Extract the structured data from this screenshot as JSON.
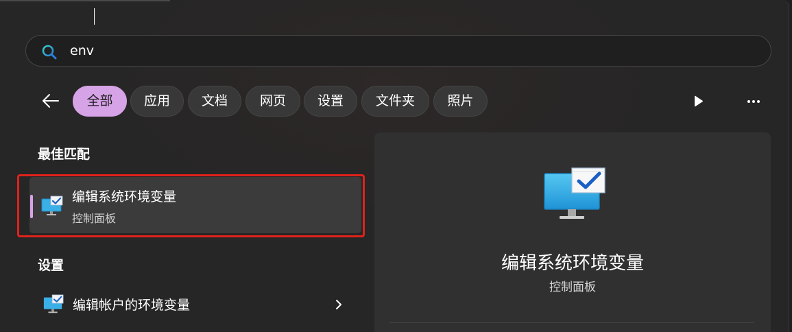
{
  "search": {
    "value": "env"
  },
  "filters": {
    "items": [
      "全部",
      "应用",
      "文档",
      "网页",
      "设置",
      "文件夹",
      "照片"
    ],
    "active_index": 0
  },
  "best_match": {
    "heading": "最佳匹配",
    "title": "编辑系统环境变量",
    "subtitle": "控制面板"
  },
  "settings_section": {
    "heading": "设置",
    "items": [
      {
        "label": "编辑帐户的环境变量"
      }
    ]
  },
  "preview": {
    "title": "编辑系统环境变量",
    "subtitle": "控制面板"
  },
  "colors": {
    "accent": "#d7a3e7",
    "highlight_border": "#e0221b",
    "panel_bg": "#262626"
  },
  "icons": {
    "search": "search-icon",
    "back": "back-arrow-icon",
    "play": "play-icon",
    "more": "more-icon",
    "app": "monitor-checkmark-icon",
    "chevron": "chevron-right-icon"
  }
}
